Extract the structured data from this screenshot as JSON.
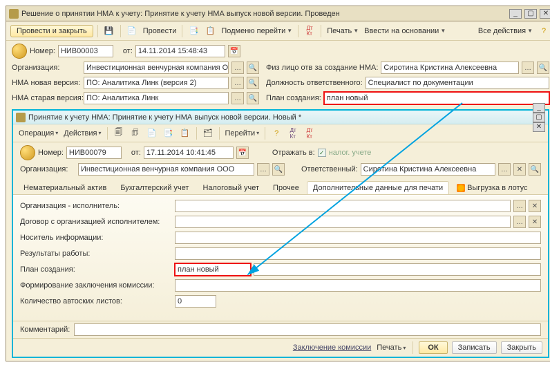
{
  "outer": {
    "title": "Решение о принятии НМА к учету: Принятие к учету НМА выпуск новой версии. Проведен",
    "toolbar": {
      "post_close": "Провести и закрыть",
      "post": "Провести",
      "submenu": "Подменю перейти",
      "print": "Печать",
      "based_on": "Ввести на основании",
      "all_actions": "Все действия"
    },
    "number_label": "Номер:",
    "number": "НИВ00003",
    "from": "от:",
    "date": "14.11.2014 15:48:43",
    "org_label": "Организация:",
    "org": "Инвестиционная венчурная компания О...",
    "fiz_label": "Физ лицо отв за создание НМА:",
    "fiz": "Сиротина Кристина Алексеевна",
    "new_ver_label": "НМА новая версия:",
    "new_ver": "ПО: Аналитика Линк (версия 2)",
    "pos_label": "Должность ответственного:",
    "pos": "Специалист по документации",
    "old_ver_label": "НМА старая версия:",
    "old_ver": "ПО: Аналитика Линк",
    "plan_label": "План создания:",
    "plan": "план новый"
  },
  "inner": {
    "title": "Принятие к учету НМА: Принятие к учету НМА выпуск новой версии. Новый *",
    "toolbar": {
      "operation": "Операция",
      "actions": "Действия",
      "goto": "Перейти"
    },
    "number_label": "Номер:",
    "number": "НИВ00079",
    "from": "от:",
    "date": "17.11.2014 10:41:45",
    "reflect_label": "Отражать в:",
    "reflect_chk": "налог. учете",
    "org_label": "Организация:",
    "org": "Инвестиционная венчурная компания ООО",
    "resp_label": "Ответственный:",
    "resp": "Сиротина Кристина Алексеевна",
    "tabs": [
      "Нематериальный актив",
      "Бухгалтерский учет",
      "Налоговый учет",
      "Прочее",
      "Дополнительные данные для печати",
      "Выгрузка в лотус"
    ],
    "fields": {
      "org_exec": "Организация - исполнитель:",
      "contract": "Договор с организацией исполнителем:",
      "media": "Носитель информации:",
      "results": "Результаты работы:",
      "plan": "План создания:",
      "plan_val": "план новый",
      "conclusion": "Формирование заключения комиссии:",
      "copies": "Количество автоских листов:",
      "copies_val": "0"
    },
    "comment_label": "Комментарий:",
    "footer": {
      "conclusion_link": "Заключение комиссии",
      "print": "Печать",
      "ok": "ОК",
      "save": "Записать",
      "close": "Закрыть"
    }
  }
}
